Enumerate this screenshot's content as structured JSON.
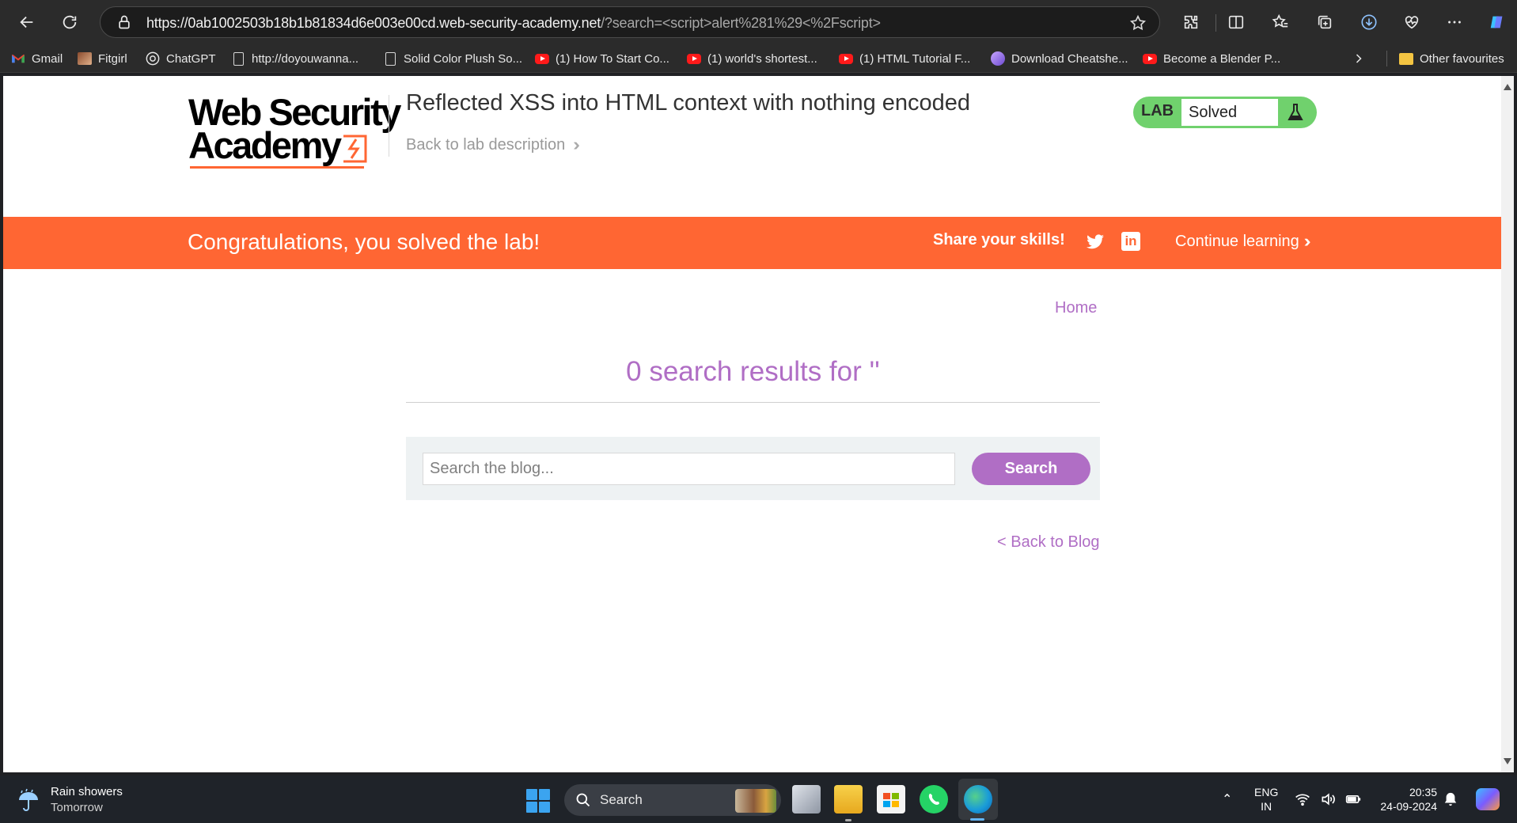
{
  "browser": {
    "url_main": "https://0ab1002503b18b1b81834d6e003e00cd.web-security-academy.net",
    "url_rest": "/?search=<script>alert%281%29<%2Fscript>",
    "bookmarks": [
      {
        "label": "Gmail",
        "icon": "gmail-icon"
      },
      {
        "label": "Fitgirl",
        "icon": "fitgirl-icon"
      },
      {
        "label": "ChatGPT",
        "icon": "chatgpt-icon"
      },
      {
        "label": "http://doyouwanna...",
        "icon": "page-icon"
      },
      {
        "label": "Solid Color Plush So...",
        "icon": "page-icon"
      },
      {
        "label": "(1) How To Start Co...",
        "icon": "youtube-icon"
      },
      {
        "label": "(1) world's shortest...",
        "icon": "youtube-icon"
      },
      {
        "label": "(1) HTML Tutorial F...",
        "icon": "youtube-icon"
      },
      {
        "label": "Download Cheatshe...",
        "icon": "avatar-icon"
      },
      {
        "label": "Become a Blender P...",
        "icon": "youtube-icon"
      }
    ],
    "other_favourites": "Other favourites"
  },
  "academy": {
    "logo_line1": "Web Security",
    "logo_line2": "Academy",
    "lab_title": "Reflected XSS into HTML context with nothing encoded",
    "back_to_description": "Back to lab description",
    "lab_badge": "LAB",
    "lab_status": "Solved",
    "colors": {
      "brand_orange": "#ff6633",
      "status_green": "#70d16d",
      "link_purple": "#b06ec5"
    }
  },
  "banner": {
    "message": "Congratulations, you solved the lab!",
    "share": "Share your skills!",
    "continue": "Continue learning"
  },
  "blog": {
    "home": "Home",
    "results_heading": "0 search results for ''",
    "search_placeholder": "Search the blog...",
    "search_button": "Search",
    "back_to_blog": "< Back to Blog"
  },
  "taskbar": {
    "weather_title": "Rain showers",
    "weather_sub": "Tomorrow",
    "search_label": "Search",
    "lang_line1": "ENG",
    "lang_line2": "IN",
    "time": "20:35",
    "date": "24-09-2024"
  }
}
